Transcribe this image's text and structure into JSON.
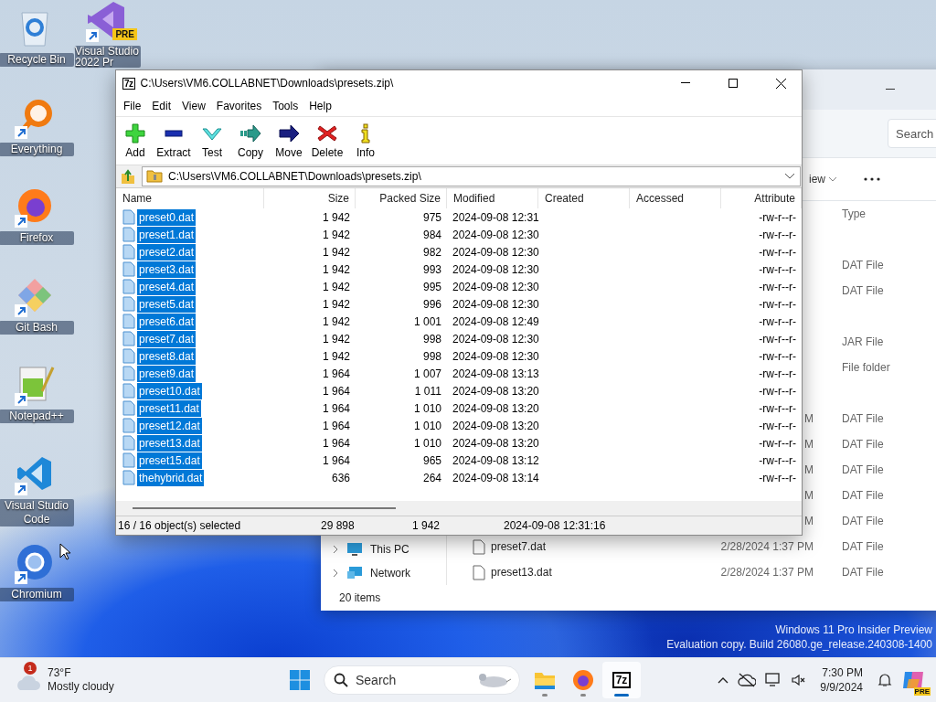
{
  "desktop": {
    "columns": [
      {
        "icons": [
          {
            "label": "Recycle Bin",
            "kind": "recycle",
            "shortcut": false
          },
          {
            "label": "Everything",
            "kind": "everything",
            "shortcut": true
          },
          {
            "label": "Firefox",
            "kind": "firefox",
            "shortcut": true
          },
          {
            "label": "Git Bash",
            "kind": "gitbash",
            "shortcut": true
          },
          {
            "label": "Notepad++",
            "kind": "notepad",
            "shortcut": true
          },
          {
            "label": "Visual Studio Code",
            "kind": "vscode",
            "shortcut": true
          },
          {
            "label": "Chromium",
            "kind": "chromium",
            "shortcut": true
          }
        ]
      },
      {
        "icons": [
          {
            "label": "Visual Studio 2022 Pr",
            "kind": "visualstudio",
            "shortcut": true,
            "badge": "PRE"
          }
        ]
      }
    ]
  },
  "explorer": {
    "search": {
      "placeholder": "Search"
    },
    "view_button": "iew",
    "type_header": "Type",
    "rows": [
      {},
      {
        "type": "DAT File"
      },
      {
        "type": "DAT File"
      },
      {},
      {
        "type": "JAR File"
      },
      {
        "type": "File folder"
      },
      {},
      {
        "date": "M",
        "type": "DAT File"
      },
      {
        "date": "M",
        "type": "DAT File"
      },
      {
        "date": "M",
        "type": "DAT File"
      },
      {
        "date": "M",
        "type": "DAT File"
      },
      {
        "date": "M",
        "type": "DAT File"
      },
      {
        "name": "preset7.dat",
        "date": "2/28/2024 1:37 PM",
        "type": "DAT File"
      },
      {
        "name": "preset13.dat",
        "date": "2/28/2024 1:37 PM",
        "type": "DAT File"
      }
    ],
    "nav": [
      {
        "label": "This PC",
        "kind": "pc"
      },
      {
        "label": "Network",
        "kind": "network"
      }
    ],
    "status": "20 items"
  },
  "sevenzip": {
    "icon_text": "7z",
    "title": "C:\\Users\\VM6.COLLABNET\\Downloads\\presets.zip\\",
    "menu": [
      "File",
      "Edit",
      "View",
      "Favorites",
      "Tools",
      "Help"
    ],
    "toolbar": [
      {
        "label": "Add",
        "kind": "add"
      },
      {
        "label": "Extract",
        "kind": "extract"
      },
      {
        "label": "Test",
        "kind": "test"
      },
      {
        "label": "Copy",
        "kind": "copy"
      },
      {
        "label": "Move",
        "kind": "move"
      },
      {
        "label": "Delete",
        "kind": "delete"
      },
      {
        "label": "Info",
        "kind": "info"
      }
    ],
    "address": "C:\\Users\\VM6.COLLABNET\\Downloads\\presets.zip\\",
    "columns": [
      "Name",
      "Size",
      "Packed Size",
      "Modified",
      "Created",
      "Accessed",
      "Attribute"
    ],
    "rows": [
      {
        "name": "preset0.dat",
        "size": "1 942",
        "packed": "975",
        "modified": "2024-09-08 12:31",
        "attributes": "-rw-r--r-",
        "selected": true
      },
      {
        "name": "preset1.dat",
        "size": "1 942",
        "packed": "984",
        "modified": "2024-09-08 12:30",
        "attributes": "-rw-r--r-",
        "selected": true
      },
      {
        "name": "preset2.dat",
        "size": "1 942",
        "packed": "982",
        "modified": "2024-09-08 12:30",
        "attributes": "-rw-r--r-",
        "selected": true
      },
      {
        "name": "preset3.dat",
        "size": "1 942",
        "packed": "993",
        "modified": "2024-09-08 12:30",
        "attributes": "-rw-r--r-",
        "selected": true
      },
      {
        "name": "preset4.dat",
        "size": "1 942",
        "packed": "995",
        "modified": "2024-09-08 12:30",
        "attributes": "-rw-r--r-",
        "selected": true
      },
      {
        "name": "preset5.dat",
        "size": "1 942",
        "packed": "996",
        "modified": "2024-09-08 12:30",
        "attributes": "-rw-r--r-",
        "selected": true
      },
      {
        "name": "preset6.dat",
        "size": "1 942",
        "packed": "1 001",
        "modified": "2024-09-08 12:49",
        "attributes": "-rw-r--r-",
        "selected": true
      },
      {
        "name": "preset7.dat",
        "size": "1 942",
        "packed": "998",
        "modified": "2024-09-08 12:30",
        "attributes": "-rw-r--r-",
        "selected": true
      },
      {
        "name": "preset8.dat",
        "size": "1 942",
        "packed": "998",
        "modified": "2024-09-08 12:30",
        "attributes": "-rw-r--r-",
        "selected": true
      },
      {
        "name": "preset9.dat",
        "size": "1 964",
        "packed": "1 007",
        "modified": "2024-09-08 13:13",
        "attributes": "-rw-r--r-",
        "selected": true
      },
      {
        "name": "preset10.dat",
        "size": "1 964",
        "packed": "1 011",
        "modified": "2024-09-08 13:20",
        "attributes": "-rw-r--r-",
        "selected": true
      },
      {
        "name": "preset11.dat",
        "size": "1 964",
        "packed": "1 010",
        "modified": "2024-09-08 13:20",
        "attributes": "-rw-r--r-",
        "selected": true
      },
      {
        "name": "preset12.dat",
        "size": "1 964",
        "packed": "1 010",
        "modified": "2024-09-08 13:20",
        "attributes": "-rw-r--r-",
        "selected": true
      },
      {
        "name": "preset13.dat",
        "size": "1 964",
        "packed": "1 010",
        "modified": "2024-09-08 13:20",
        "attributes": "-rw-r--r-",
        "selected": true
      },
      {
        "name": "preset15.dat",
        "size": "1 964",
        "packed": "965",
        "modified": "2024-09-08 13:12",
        "attributes": "-rw-r--r-",
        "selected": true
      },
      {
        "name": "thehybrid.dat",
        "size": "636",
        "packed": "264",
        "modified": "2024-09-08 13:14",
        "attributes": "-rw-r--r-",
        "selected": true
      }
    ],
    "status": [
      "16 / 16 object(s) selected",
      "29 898",
      "1 942",
      "2024-09-08 12:31:16"
    ]
  },
  "os_watermark": [
    "Windows 11 Pro Insider Preview",
    "Evaluation copy. Build 26080.ge_release.240308-1400"
  ],
  "taskbar": {
    "weather": {
      "badge": "1",
      "temperature": "73°F",
      "condition": "Mostly cloudy"
    },
    "search": {
      "placeholder": "Search"
    },
    "apps": [
      {
        "kind": "explorer",
        "selected": false
      },
      {
        "kind": "firefox",
        "selected": false
      },
      {
        "kind": "sevenzip",
        "label": "7z",
        "selected": true
      }
    ],
    "clock": {
      "time": "7:30 PM",
      "date": "9/9/2024"
    },
    "copilot_badge": "PRE"
  }
}
